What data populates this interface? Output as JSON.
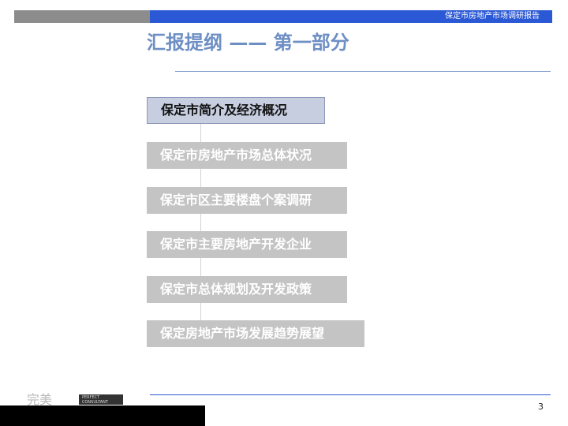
{
  "header": {
    "report_title": "保定市房地产市场调研报告"
  },
  "title": "汇报提纲 —— 第一部分",
  "menu": {
    "items": [
      {
        "label": "保定市简介及经济概况",
        "active": true
      },
      {
        "label": "保定市房地产市场总体状况",
        "active": false
      },
      {
        "label": "保定市区主要楼盘个案调研",
        "active": false
      },
      {
        "label": "保定市主要房地产开发企业",
        "active": false
      },
      {
        "label": "保定市总体规划及开发政策",
        "active": false
      },
      {
        "label": "保定房地产市场发展趋势展望",
        "active": false
      }
    ]
  },
  "footer": {
    "logo_text": "完美",
    "logo_sub": "PERFECT CONSULTANT",
    "page_number": "3"
  }
}
